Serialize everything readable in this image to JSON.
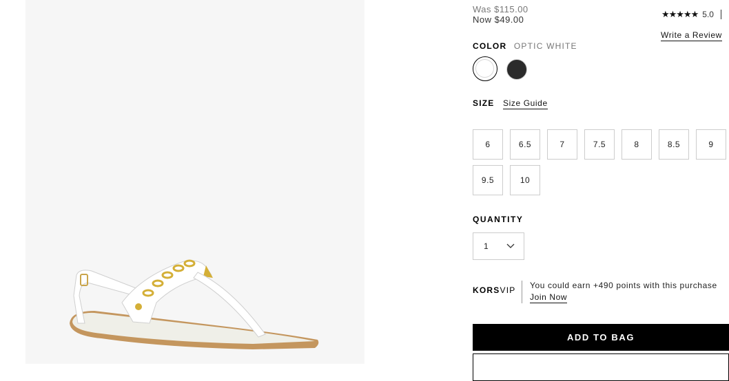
{
  "price": {
    "was": "Was $115.00",
    "now": "Now $49.00"
  },
  "rating": {
    "stars": "★★★★★",
    "score": "5.0",
    "write_review": "Write a Review"
  },
  "color": {
    "label": "COLOR",
    "selected": "OPTIC WHITE",
    "swatches": [
      {
        "name": "optic-white",
        "hex": "#ffffff",
        "selected": true
      },
      {
        "name": "black",
        "hex": "#2b2b2b",
        "selected": false
      }
    ]
  },
  "size": {
    "label": "SIZE",
    "guide": "Size Guide",
    "options": [
      "6",
      "6.5",
      "7",
      "7.5",
      "8",
      "8.5",
      "9",
      "9.5",
      "10"
    ]
  },
  "quantity": {
    "label": "QUANTITY",
    "value": "1"
  },
  "korsvip": {
    "logo_bold": "KORS",
    "logo_light": "VIP",
    "message": "You could earn +490 points with this purchase",
    "join": "Join Now"
  },
  "actions": {
    "add_to_bag": "ADD TO BAG"
  },
  "colors": {
    "accent": "#000000",
    "image_background": "#f6f6f6",
    "border": "#cccccc"
  }
}
